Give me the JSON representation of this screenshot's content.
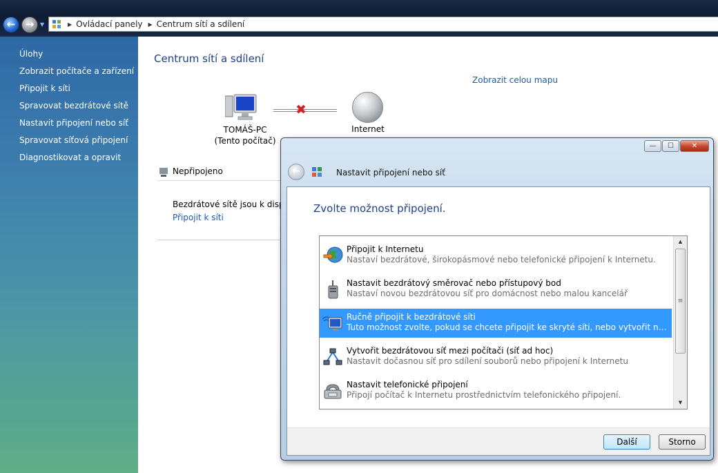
{
  "address_bar": {
    "crumbs": [
      "Ovládací panely",
      "Centrum sítí a sdílení"
    ]
  },
  "taskpane": {
    "items": [
      {
        "label": "Úlohy"
      },
      {
        "label": "Zobrazit počítače a zařízení"
      },
      {
        "label": "Připojit k síti"
      },
      {
        "label": "Spravovat bezdrátové sítě"
      },
      {
        "label": "Nastavit připojení nebo síť"
      },
      {
        "label": "Spravovat síťová připojení"
      },
      {
        "label": "Diagnostikovat a opravit"
      }
    ]
  },
  "main": {
    "title": "Centrum sítí a sdílení",
    "full_map_link": "Zobrazit celou mapu",
    "computer_name": "TOMÁŠ-PC",
    "computer_sub": "(Tento počítač)",
    "internet_label": "Internet",
    "status": "Nepřipojeno",
    "wireless_text": "Bezdrátové sítě jsou k dispozici",
    "connect_link": "Připojit k síti"
  },
  "dialog": {
    "title": "Nastavit připojení nebo síť",
    "heading": "Zvolte možnost připojení.",
    "options": [
      {
        "title": "Připojit k Internetu",
        "desc": "Nastaví bezdrátové, širokopásmové nebo telefonické připojení k Internetu.",
        "icon": "internet-globe-icon",
        "selected": false
      },
      {
        "title": "Nastavit bezdrátový směrovač nebo přístupový bod",
        "desc": "Nastaví novou bezdrátovou síť pro domácnost nebo malou kancelář",
        "icon": "router-icon",
        "selected": false
      },
      {
        "title": "Ručně připojit k bezdrátové síti",
        "desc": "Tuto možnost zvolte, pokud se chcete připojit ke skryté síti, nebo vytvořit nový bezdrátový profil.",
        "icon": "wireless-monitor-icon",
        "selected": true
      },
      {
        "title": "Vytvořit bezdrátovou síť mezi počítači (síť ad hoc)",
        "desc": "Nastavit dočasnou síť pro sdílení souborů nebo připojení k Internetu",
        "icon": "adhoc-network-icon",
        "selected": false
      },
      {
        "title": "Nastavit telefonické připojení",
        "desc": "Připojí počítač k Internetu prostřednictvím telefonického připojení.",
        "icon": "phone-modem-icon",
        "selected": false
      }
    ],
    "next_label": "Další",
    "cancel_label": "Storno",
    "win_minimize": "—",
    "win_maximize": "☐",
    "win_close": "✕"
  },
  "colors": {
    "accent_heading": "#1e3f8a",
    "link": "#1c5ab0",
    "selection": "#3399ff"
  }
}
